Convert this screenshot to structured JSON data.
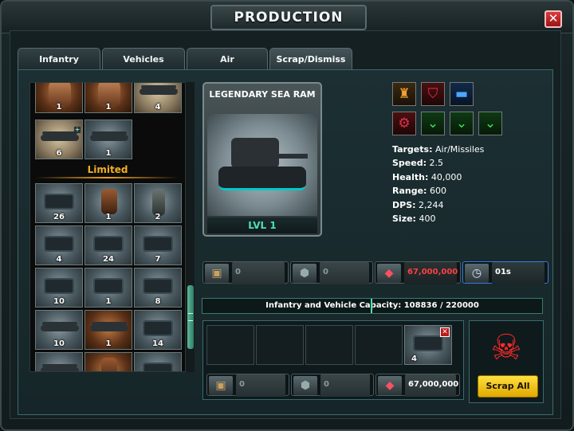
{
  "window": {
    "title": "PRODUCTION",
    "close_label": "✕"
  },
  "tabs": [
    {
      "label": "Infantry",
      "active": false
    },
    {
      "label": "Vehicles",
      "active": false
    },
    {
      "label": "Air",
      "active": false
    },
    {
      "label": "Scrap/Dismiss",
      "active": true
    }
  ],
  "unit_list": {
    "section_label": "Limited",
    "standard_units": [
      {
        "count": "1",
        "icon": "commando-portrait-icon"
      },
      {
        "count": "1",
        "icon": "commando-portrait-icon"
      },
      {
        "count": "4",
        "icon": "gunship-icon"
      },
      {
        "count": "6",
        "icon": "bomber-plane-icon"
      },
      {
        "count": "1",
        "icon": "bomber-plane-icon"
      }
    ],
    "limited_units": [
      {
        "count": "26",
        "icon": "artillery-icon"
      },
      {
        "count": "1",
        "icon": "mech-icon"
      },
      {
        "count": "2",
        "icon": "soldier-icon"
      },
      {
        "count": "4",
        "icon": "tank-icon"
      },
      {
        "count": "24",
        "icon": "tank-icon"
      },
      {
        "count": "7",
        "icon": "tank-icon"
      },
      {
        "count": "10",
        "icon": "tank-icon"
      },
      {
        "count": "1",
        "icon": "tank-icon"
      },
      {
        "count": "8",
        "icon": "tank-icon"
      },
      {
        "count": "10",
        "icon": "jet-icon"
      },
      {
        "count": "1",
        "icon": "jet-icon"
      },
      {
        "count": "14",
        "icon": "tank-icon"
      },
      {
        "count": "",
        "icon": "gunship-icon"
      },
      {
        "count": "",
        "icon": "mech-icon"
      },
      {
        "count": "",
        "icon": "tank-icon"
      }
    ]
  },
  "detail": {
    "name": "LEGENDARY SEA RAM",
    "level": "LVL 1",
    "stats": [
      {
        "label": "Targets:",
        "value": "Air/Missiles"
      },
      {
        "label": "Speed:",
        "value": "2.5"
      },
      {
        "label": "Health:",
        "value": "40,000"
      },
      {
        "label": "Range:",
        "value": "600"
      },
      {
        "label": "DPS:",
        "value": "2,244"
      },
      {
        "label": "Size:",
        "value": "400"
      }
    ],
    "badges": [
      {
        "icon": "tower-icon",
        "color": "orange",
        "glyph": "♜"
      },
      {
        "icon": "shield-icon",
        "color": "red",
        "glyph": "⛉"
      },
      {
        "icon": "vehicle-icon",
        "color": "blue",
        "glyph": "▬"
      },
      {
        "icon": "gear-icon",
        "color": "red",
        "glyph": "⚙"
      },
      {
        "icon": "rank-chevron-icon",
        "color": "green",
        "glyph": "⌄"
      },
      {
        "icon": "rank-chevron-icon",
        "color": "green",
        "glyph": "⌄"
      },
      {
        "icon": "rank-chevron-icon",
        "color": "green",
        "glyph": "⌄"
      }
    ]
  },
  "cost": {
    "supplies": "0",
    "metal": "0",
    "crystals": "67,000,000",
    "time": "01s"
  },
  "capacity": {
    "label": "Infantry and Vehicle Capacity: 108836 / 220000",
    "used": 108836,
    "total": 220000
  },
  "queue": {
    "slots": 4,
    "item_count": "4",
    "supplies": "0",
    "metal": "0",
    "crystals": "67,000,000",
    "remove_label": "✕"
  },
  "scrap": {
    "button_label": "Scrap All"
  },
  "colors": {
    "accent": "#4fe0b0",
    "warning": "#ff4040",
    "limited": "#f0b020",
    "button": "#f0c020"
  }
}
